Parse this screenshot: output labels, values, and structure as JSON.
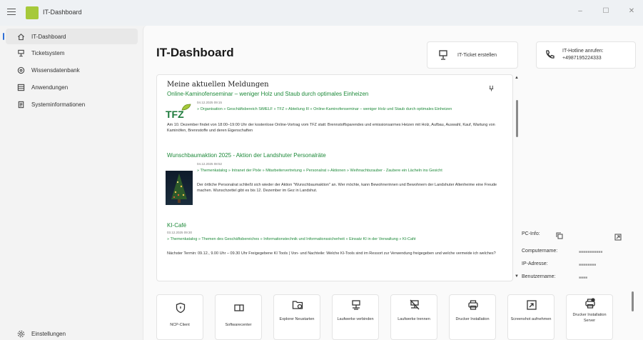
{
  "app": {
    "title": "IT-Dashboard",
    "window_controls": [
      "–",
      "☐",
      "✕"
    ]
  },
  "sidebar": {
    "items": [
      {
        "label": "IT-Dashboard",
        "icon": "home-icon",
        "active": true
      },
      {
        "label": "Ticketsystem",
        "icon": "ticket-icon",
        "active": false
      },
      {
        "label": "Wissensdatenbank",
        "icon": "knowledge-icon",
        "active": false
      },
      {
        "label": "Anwendungen",
        "icon": "apps-icon",
        "active": false
      },
      {
        "label": "Systeminformationen",
        "icon": "system-info-icon",
        "active": false
      }
    ],
    "settings_label": "Einstellungen"
  },
  "header": {
    "page_title": "IT-Dashboard",
    "ticket_button": "IT-Ticket erstellen",
    "hotline_label": "IT-Hotline anrufen:",
    "hotline_number": "+4987195224333"
  },
  "news": {
    "header": "Meine aktuellen Meldungen",
    "entries": [
      {
        "title": "Online-Kaminofenseminar – weniger Holz und Staub durch optimales Einheizen",
        "date": "04.12.2025 09:15",
        "path": "» Organisation » Geschäftsbereich StMELF » TFZ » Abteilung III » Online-Kaminofenseminar – weniger Holz und Staub durch optimales Einheizen",
        "text": "Am 10. Dezember findet von 18:00–19:00 Uhr der kostenlose Online-Vortrag vom TFZ statt: Brennstoffsparendes und emissionsarmes Heizen mit Holz, Aufbau, Auswahl, Kauf, Wartung von Kaminöfen, Brennstoffe und deren Eigenschaften"
      },
      {
        "title": "Wunschbaumaktion 2025 - Aktion der Landshuter Personalräte",
        "date": "04.12.2025 08:52",
        "path": "» Themenkatalog » Intranet der Pixle » Mitarbeitervertretung » Personalrat » Aktionen » Weihnachtszauber - Zaubere ein Lächeln ins Gesicht",
        "text": "Der örtliche Personalrat schließt sich wieder der Aktion \"Wunschbaumaktion\" an. Wer möchte, kann Bewohnerinnen und Bewohnern der Landshuter Altenheime eine Freude machen. Wunschzettel gibt es bis 12. Dezember im Gez in Landshut."
      },
      {
        "title": "KI-Café",
        "date": "03.12.2025 09:30",
        "path": "» Themenkatalog » Themen des Geschäftsbereiches » Informationstechnik und Informationssicherheit » Einsatz KI in der Verwaltung » KI-Café",
        "text": "Nächster Termin: 09.12., 9.00 Uhr – 09.30 Uhr Freigegebene KI Tools | Von- und Nachteile: Welche KI-Tools sind im Ressort zur Verwendung freigegeben und welche vermeide ich welches?"
      }
    ]
  },
  "pcinfo": {
    "label": "PC-Info:",
    "rows": [
      {
        "label": "Computername:",
        "value": "■■■■■■■■■■■"
      },
      {
        "label": "IP-Adresse:",
        "value": "■■■■■■■■"
      },
      {
        "label": "Benutzername:",
        "value": "■■■■"
      }
    ]
  },
  "tools": [
    {
      "label": "NCP-Client",
      "icon": "shield-icon"
    },
    {
      "label": "Softwarecenter",
      "icon": "software-center-icon"
    },
    {
      "label": "Explorer Neustarten",
      "icon": "folder-refresh-icon"
    },
    {
      "label": "Laufwerke verbinden",
      "icon": "network-drive-icon"
    },
    {
      "label": "Laufwerke trennen",
      "icon": "disconnect-drive-icon"
    },
    {
      "label": "Drucker Installation",
      "icon": "printer-icon"
    },
    {
      "label": "Screenshot aufnehmen",
      "icon": "screenshot-icon"
    },
    {
      "label": "Drucker Installation Server",
      "icon": "printer-server-icon"
    }
  ]
}
